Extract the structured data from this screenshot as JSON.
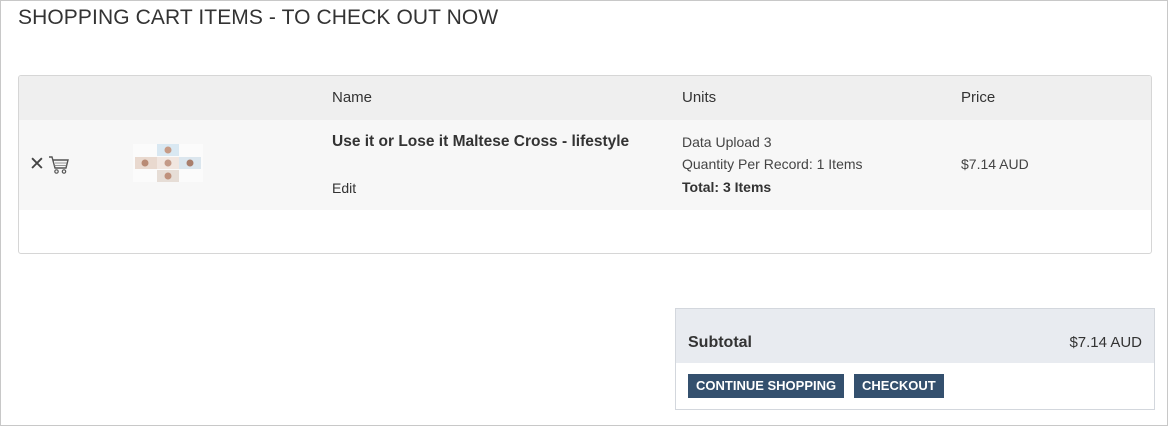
{
  "page": {
    "title": "SHOPPING CART ITEMS - TO CHECK OUT NOW"
  },
  "table": {
    "headers": {
      "name": "Name",
      "units": "Units",
      "price": "Price"
    },
    "rows": [
      {
        "name": "Use it or Lose it Maltese Cross - lifestyle",
        "edit_label": "Edit",
        "units": [
          "Data Upload 3",
          "Quantity Per Record: 1 Items",
          "Total: 3 Items"
        ],
        "price": "$7.14 AUD",
        "remove_icon": "close-icon",
        "cart_icon": "cart-icon"
      }
    ]
  },
  "summary": {
    "subtotal_label": "Subtotal",
    "subtotal_value": "$7.14 AUD",
    "continue_label": "CONTINUE SHOPPING",
    "checkout_label": "CHECKOUT"
  },
  "colors": {
    "button_bg": "#34506e",
    "header_bg": "#efefef",
    "summary_head_bg": "#e8ebf0"
  }
}
